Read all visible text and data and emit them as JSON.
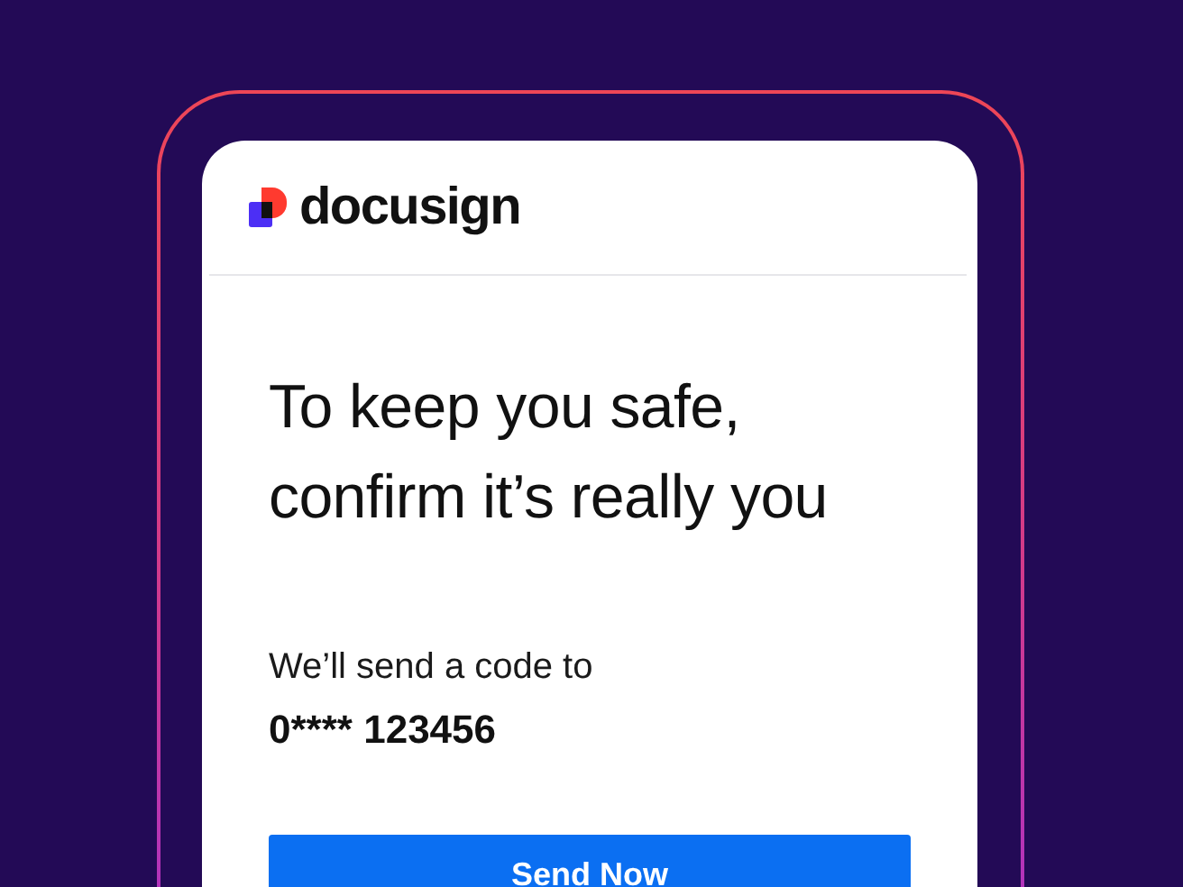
{
  "brand": {
    "name": "docusign"
  },
  "heading": [
    "To keep you safe,",
    "confirm it’s really you"
  ],
  "message": "We’ll send a code to",
  "phone_number": "0**** 123456",
  "buttons": [
    {
      "label": "Send Now",
      "kind": "primary"
    }
  ]
}
